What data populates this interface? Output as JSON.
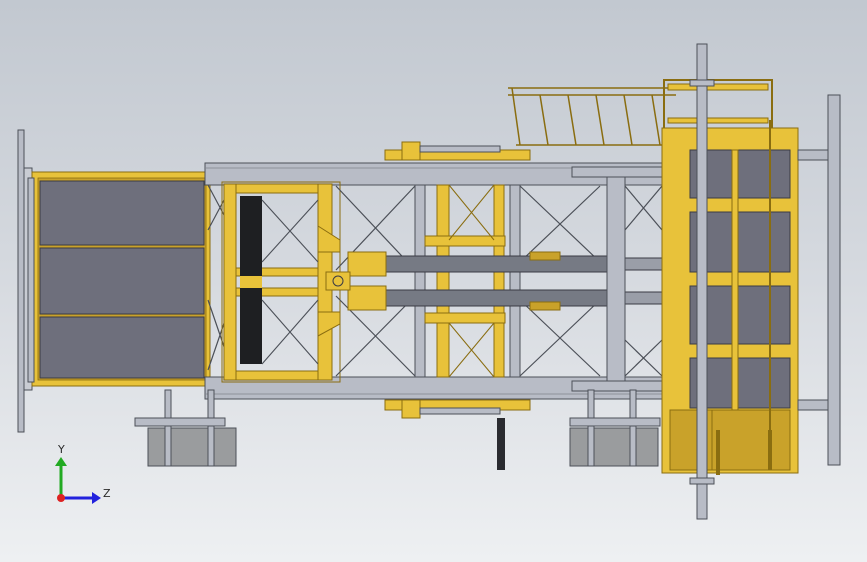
{
  "viewport": {
    "background_top": "#c2c8d0",
    "background_bottom": "#eef0f2"
  },
  "colors": {
    "yellow": "#e8c23a",
    "yellow_dark": "#8a6d10",
    "panel_gray": "#6e6f7c",
    "steel": "#b8bcc6",
    "steel_dark": "#4c5058",
    "hydraulic": "#767a84",
    "counterweight": "#9a9c9e"
  },
  "axes_triad": {
    "y_label": "Y",
    "z_label": "Z",
    "y_color": "#22aa22",
    "z_color": "#2222dd",
    "origin_color": "#dd2222"
  }
}
